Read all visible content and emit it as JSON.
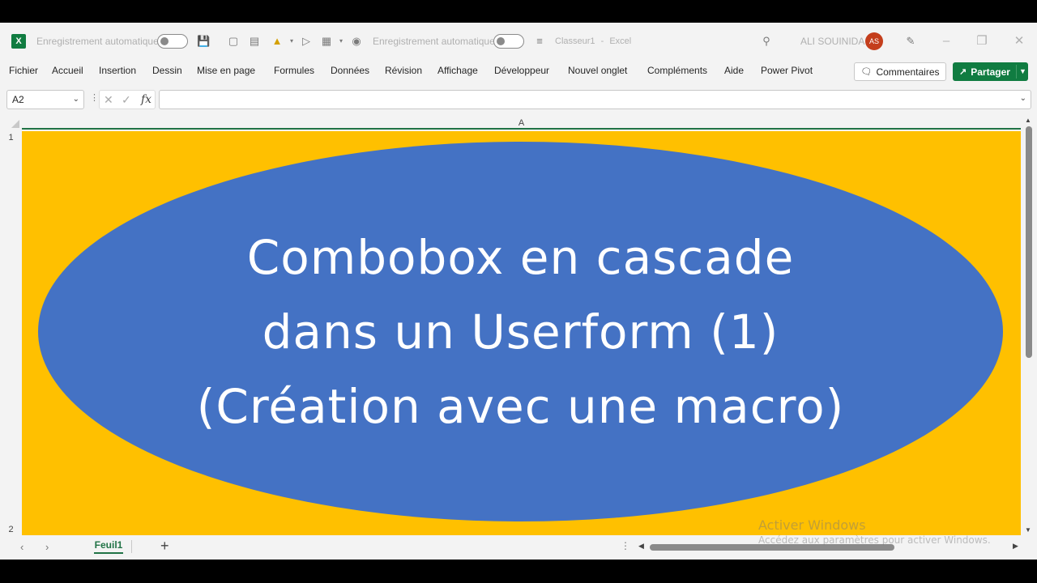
{
  "titlebar": {
    "autosave_label": "Enregistrement automatique",
    "autosave_label_2": "Enregistrement automatique",
    "filename": "Classeur1",
    "app_separator": "-",
    "app_name": "Excel",
    "user_name": "ALI SOUINIDA",
    "user_initials": "AS",
    "logo_letter": "X"
  },
  "menu": {
    "items": [
      "Fichier",
      "Accueil",
      "Insertion",
      "Dessin",
      "Mise en page",
      "Formules",
      "Données",
      "Révision",
      "Affichage",
      "Développeur",
      "Nouvel onglet",
      "Compléments",
      "Aide",
      "Power Pivot"
    ],
    "comments_label": "Commentaires",
    "share_label": "Partager"
  },
  "formula_bar": {
    "name_box": "A2",
    "fx_symbol": "fx",
    "value": ""
  },
  "grid": {
    "column_header": "A",
    "row_numbers": [
      "1",
      "2"
    ],
    "shape_text": [
      "Combobox en cascade",
      "dans un Userform (1)",
      "(Création avec une macro)"
    ],
    "cell_fill_color": "#ffc000",
    "shape_fill_color": "#4472c4"
  },
  "sheets": {
    "active_tab": "Feuil1",
    "add_label": "+"
  },
  "watermark": {
    "line1": "Activer Windows",
    "line2": "Accédez aux paramètres pour activer Windows."
  },
  "colors": {
    "excel_green": "#217346",
    "share_green": "#107c41",
    "avatar": "#c43e1c"
  }
}
